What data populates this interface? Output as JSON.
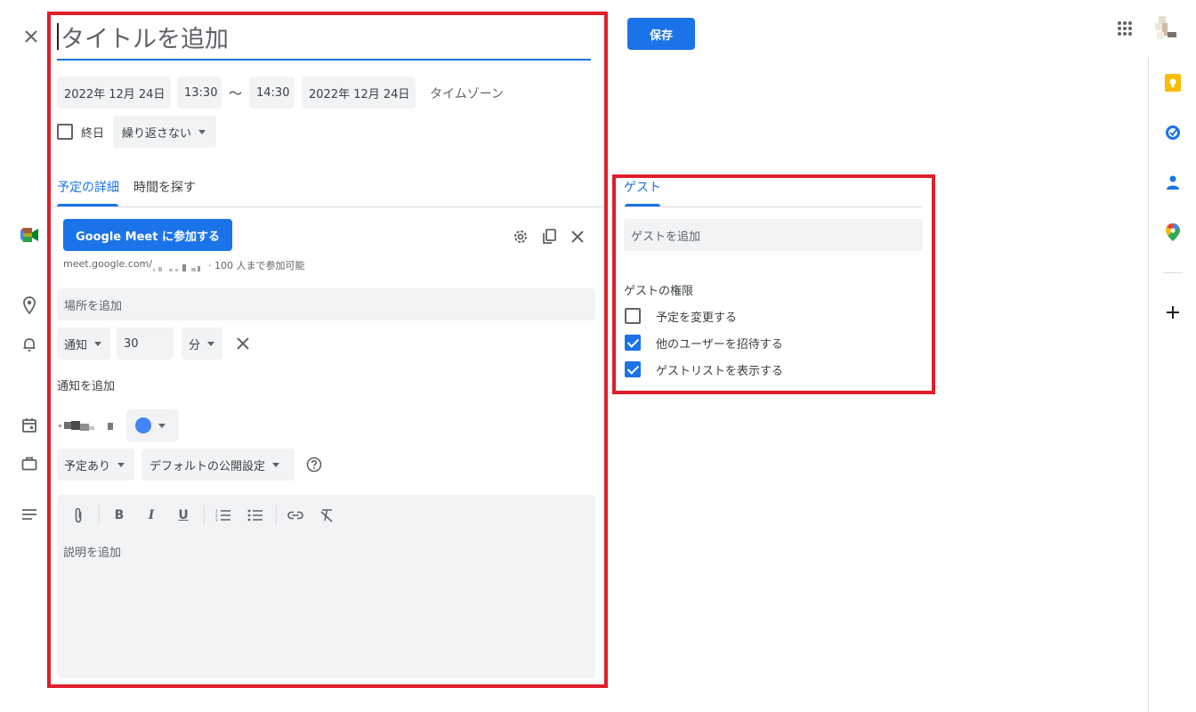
{
  "header": {
    "title_placeholder": "タイトルを追加",
    "save_label": "保存"
  },
  "datetime": {
    "start_date": "2022年 12月 24日",
    "start_time": "13:30",
    "separator": "〜",
    "end_time": "14:30",
    "end_date": "2022年 12月 24日",
    "timezone_label": "タイムゾーン",
    "all_day_label": "終日",
    "all_day_checked": false,
    "repeat_label": "繰り返さない"
  },
  "tabs": [
    {
      "label": "予定の詳細",
      "active": true
    },
    {
      "label": "時間を探す",
      "active": false
    }
  ],
  "meet": {
    "join_label": "Google Meet に参加する",
    "info_prefix": "meet.google.com/",
    "info_suffix": "· 100 人まで参加可能"
  },
  "location": {
    "placeholder": "場所を追加"
  },
  "notification": {
    "type": "通知",
    "value": "30",
    "unit": "分",
    "add_label": "通知を追加"
  },
  "calendar": {
    "color": "#4285f4"
  },
  "availability": {
    "busy_label": "予定あり",
    "visibility_label": "デフォルトの公開設定"
  },
  "description": {
    "placeholder": "説明を追加"
  },
  "guests": {
    "tab_label": "ゲスト",
    "add_placeholder": "ゲストを追加",
    "permissions_title": "ゲストの権限",
    "permissions": [
      {
        "label": "予定を変更する",
        "checked": false
      },
      {
        "label": "他のユーザーを招待する",
        "checked": true
      },
      {
        "label": "ゲストリストを表示する",
        "checked": true
      }
    ]
  },
  "colors": {
    "accent": "#1a73e8",
    "highlight_border": "#e01e2b",
    "keep": "#fbbc04",
    "field_bg": "#f1f3f4"
  }
}
